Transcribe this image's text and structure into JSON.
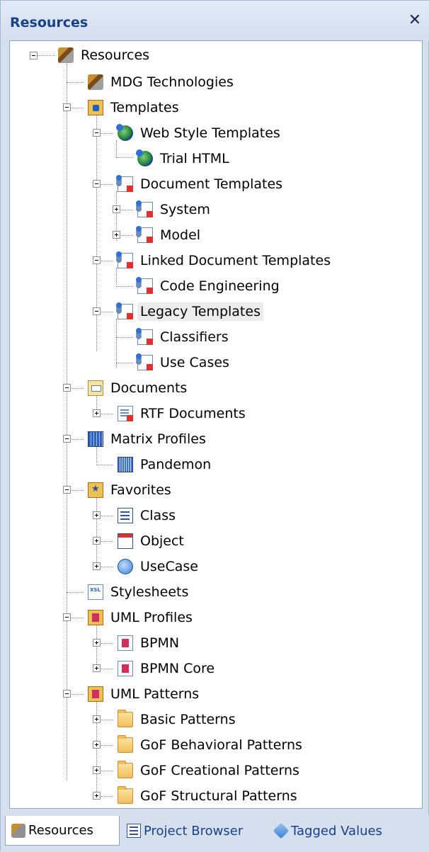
{
  "panel": {
    "title": "Resources",
    "close_glyph": "✕"
  },
  "tree": {
    "root": "Resources",
    "mdg": "MDG Technologies",
    "templates": "Templates",
    "web_style": "Web Style Templates",
    "trial_html": "Trial HTML",
    "doc_templates": "Document Templates",
    "system": "System",
    "model": "Model",
    "linked_doc": "Linked Document Templates",
    "code_eng": "Code Engineering",
    "legacy": "Legacy Templates",
    "classifiers": "Classifiers",
    "use_cases": "Use Cases",
    "documents": "Documents",
    "rtf_docs": "RTF Documents",
    "matrix_profiles": "Matrix Profiles",
    "pandemon": "Pandemon",
    "favorites": "Favorites",
    "class": "Class",
    "object": "Object",
    "usecase": "UseCase",
    "stylesheets": "Stylesheets",
    "uml_profiles": "UML Profiles",
    "bpmn": "BPMN",
    "bpmn_core": "BPMN Core",
    "uml_patterns": "UML Patterns",
    "basic_patterns": "Basic Patterns",
    "gof_behavioral": "GoF Behavioral Patterns",
    "gof_creational": "GoF Creational Patterns",
    "gof_structural": "GoF Structural Patterns"
  },
  "tabs": {
    "resources": "Resources",
    "project_browser": "Project Browser",
    "tagged_values": "Tagged Values"
  },
  "colors": {
    "title_text": "#15428b",
    "selection": "#ececec"
  }
}
